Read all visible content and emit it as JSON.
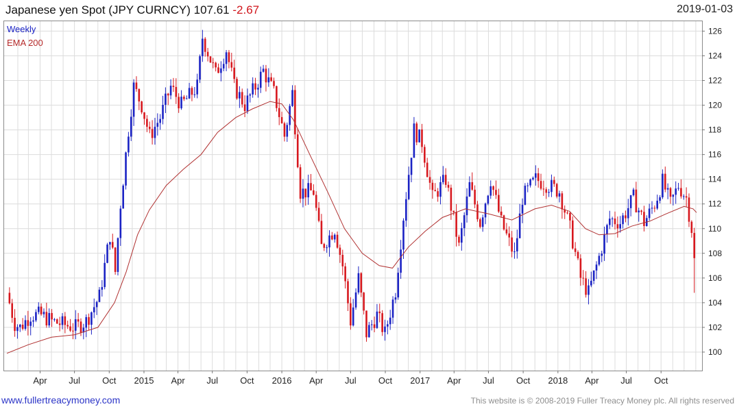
{
  "header": {
    "title": "Japanese yen Spot (JPY CURNCY) 107.61",
    "change": "-2.67",
    "date": "2019-01-03"
  },
  "legend": {
    "weekly": "Weekly",
    "ema": "EMA 200"
  },
  "footer": {
    "site": "www.fullertreacymoney.com",
    "copyright": "This website is © 2008-2019 Fuller Treacy Money plc. All rights reserved"
  },
  "colors": {
    "up": "#1a22c4",
    "down": "#d7181e",
    "ema": "#b03030",
    "grid": "#dcdcdc"
  },
  "chart_data": {
    "type": "candlestick",
    "title": "Japanese yen Spot (JPY CURNCY) 107.61 -2.67",
    "frequency": "Weekly",
    "xlabel": "",
    "ylabel": "",
    "ylim": [
      98.5,
      126.8
    ],
    "yticks": [
      100,
      102,
      104,
      106,
      108,
      110,
      112,
      114,
      116,
      118,
      120,
      122,
      124,
      126
    ],
    "x_range": [
      "2014-01-03",
      "2019-01-03"
    ],
    "x_ticks": [
      {
        "label": "Apr",
        "date": "2014-04-01"
      },
      {
        "label": "Jul",
        "date": "2014-07-01"
      },
      {
        "label": "Oct",
        "date": "2014-10-01"
      },
      {
        "label": "2015",
        "date": "2015-01-01"
      },
      {
        "label": "Apr",
        "date": "2015-04-01"
      },
      {
        "label": "Jul",
        "date": "2015-07-01"
      },
      {
        "label": "Oct",
        "date": "2015-10-01"
      },
      {
        "label": "2016",
        "date": "2016-01-01"
      },
      {
        "label": "Apr",
        "date": "2016-04-01"
      },
      {
        "label": "Jul",
        "date": "2016-07-01"
      },
      {
        "label": "Oct",
        "date": "2016-10-01"
      },
      {
        "label": "2017",
        "date": "2017-01-01"
      },
      {
        "label": "Apr",
        "date": "2017-04-01"
      },
      {
        "label": "Jul",
        "date": "2017-07-01"
      },
      {
        "label": "Oct",
        "date": "2017-10-01"
      },
      {
        "label": "2018",
        "date": "2018-01-01"
      },
      {
        "label": "Apr",
        "date": "2018-04-01"
      },
      {
        "label": "Jul",
        "date": "2018-07-01"
      },
      {
        "label": "Oct",
        "date": "2018-10-01"
      }
    ],
    "grid": true,
    "close_path": [
      [
        "2014-01-03",
        104.8
      ],
      [
        "2014-01-24",
        102.3
      ],
      [
        "2014-02-07",
        102.0
      ],
      [
        "2014-03-07",
        103.0
      ],
      [
        "2014-04-04",
        103.0
      ],
      [
        "2014-05-02",
        102.5
      ],
      [
        "2014-06-06",
        102.2
      ],
      [
        "2014-07-04",
        102.0
      ],
      [
        "2014-08-01",
        102.5
      ],
      [
        "2014-09-05",
        104.5
      ],
      [
        "2014-10-03",
        109.5
      ],
      [
        "2014-10-17",
        106.5
      ],
      [
        "2014-10-31",
        112.0
      ],
      [
        "2014-11-21",
        118.0
      ],
      [
        "2014-12-05",
        121.5
      ],
      [
        "2014-12-26",
        120.0
      ],
      [
        "2015-01-16",
        117.5
      ],
      [
        "2015-02-13",
        119.0
      ],
      [
        "2015-03-13",
        121.5
      ],
      [
        "2015-04-10",
        120.0
      ],
      [
        "2015-05-22",
        121.5
      ],
      [
        "2015-06-05",
        125.5
      ],
      [
        "2015-07-10",
        122.5
      ],
      [
        "2015-08-07",
        124.5
      ],
      [
        "2015-08-28",
        121.5
      ],
      [
        "2015-09-25",
        120.0
      ],
      [
        "2015-10-23",
        121.5
      ],
      [
        "2015-11-13",
        122.8
      ],
      [
        "2015-12-11",
        121.0
      ],
      [
        "2016-01-08",
        117.5
      ],
      [
        "2016-01-29",
        121.0
      ],
      [
        "2016-02-19",
        113.0
      ],
      [
        "2016-03-25",
        113.0
      ],
      [
        "2016-04-15",
        108.5
      ],
      [
        "2016-05-20",
        110.0
      ],
      [
        "2016-06-10",
        107.0
      ],
      [
        "2016-07-01",
        102.5
      ],
      [
        "2016-07-22",
        106.0
      ],
      [
        "2016-08-12",
        101.5
      ],
      [
        "2016-09-09",
        103.0
      ],
      [
        "2016-09-30",
        101.5
      ],
      [
        "2016-10-28",
        105.0
      ],
      [
        "2016-11-18",
        111.0
      ],
      [
        "2016-12-16",
        118.0
      ],
      [
        "2017-01-06",
        117.0
      ],
      [
        "2017-02-03",
        112.5
      ],
      [
        "2017-03-10",
        114.0
      ],
      [
        "2017-04-14",
        108.5
      ],
      [
        "2017-05-12",
        113.5
      ],
      [
        "2017-06-09",
        110.5
      ],
      [
        "2017-07-07",
        114.0
      ],
      [
        "2017-08-04",
        110.5
      ],
      [
        "2017-09-08",
        107.8
      ],
      [
        "2017-09-29",
        112.5
      ],
      [
        "2017-11-03",
        114.0
      ],
      [
        "2017-12-08",
        113.5
      ],
      [
        "2018-01-05",
        113.0
      ],
      [
        "2018-02-02",
        110.0
      ],
      [
        "2018-03-02",
        106.0
      ],
      [
        "2018-03-23",
        104.8
      ],
      [
        "2018-04-20",
        107.7
      ],
      [
        "2018-05-18",
        110.8
      ],
      [
        "2018-06-15",
        110.5
      ],
      [
        "2018-07-20",
        112.5
      ],
      [
        "2018-08-17",
        110.5
      ],
      [
        "2018-09-14",
        112.0
      ],
      [
        "2018-10-05",
        113.8
      ],
      [
        "2018-10-26",
        112.0
      ],
      [
        "2018-11-16",
        113.5
      ],
      [
        "2018-12-07",
        112.5
      ],
      [
        "2018-12-21",
        110.0
      ],
      [
        "2019-01-03",
        107.6
      ]
    ],
    "last": {
      "close": 107.61,
      "low": 104.8
    },
    "ema_200": [
      [
        "2014-01-03",
        99.9
      ],
      [
        "2014-03-01",
        100.6
      ],
      [
        "2014-05-01",
        101.2
      ],
      [
        "2014-07-01",
        101.4
      ],
      [
        "2014-09-01",
        102.0
      ],
      [
        "2014-10-15",
        104.0
      ],
      [
        "2014-11-15",
        106.5
      ],
      [
        "2014-12-15",
        109.5
      ],
      [
        "2015-01-15",
        111.5
      ],
      [
        "2015-03-01",
        113.5
      ],
      [
        "2015-04-15",
        114.8
      ],
      [
        "2015-06-01",
        116.0
      ],
      [
        "2015-07-15",
        117.8
      ],
      [
        "2015-09-01",
        119.0
      ],
      [
        "2015-10-15",
        119.7
      ],
      [
        "2015-12-01",
        120.3
      ],
      [
        "2016-01-01",
        120.1
      ],
      [
        "2016-02-01",
        118.8
      ],
      [
        "2016-03-15",
        116.0
      ],
      [
        "2016-05-01",
        113.0
      ],
      [
        "2016-06-15",
        110.0
      ],
      [
        "2016-08-01",
        108.0
      ],
      [
        "2016-09-15",
        107.0
      ],
      [
        "2016-10-20",
        106.8
      ],
      [
        "2016-12-01",
        108.5
      ],
      [
        "2017-01-15",
        109.8
      ],
      [
        "2017-03-01",
        110.9
      ],
      [
        "2017-05-01",
        111.6
      ],
      [
        "2017-07-01",
        111.2
      ],
      [
        "2017-09-01",
        110.7
      ],
      [
        "2017-11-01",
        111.6
      ],
      [
        "2017-12-15",
        111.9
      ],
      [
        "2018-02-01",
        111.4
      ],
      [
        "2018-03-15",
        110.0
      ],
      [
        "2018-04-20",
        109.5
      ],
      [
        "2018-06-01",
        109.6
      ],
      [
        "2018-07-15",
        110.2
      ],
      [
        "2018-09-01",
        110.6
      ],
      [
        "2018-10-15",
        111.2
      ],
      [
        "2018-12-01",
        111.8
      ],
      [
        "2018-12-25",
        111.6
      ],
      [
        "2019-01-03",
        111.3
      ]
    ]
  }
}
